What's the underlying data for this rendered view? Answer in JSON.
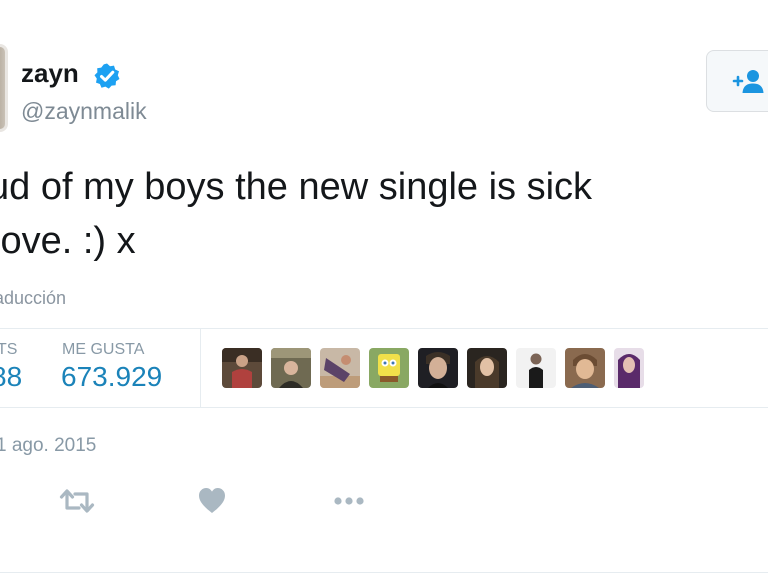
{
  "author": {
    "name": "zayn",
    "handle": "@zaynmalik",
    "verified_icon": "verified-badge-icon",
    "avatar": "profile-photo"
  },
  "follow_button": {
    "icon": "follow-person-plus-icon"
  },
  "tweet": {
    "line_1": "ud of my boys the new single is sick",
    "line_2": "love. :) x",
    "translate_label": "aducción"
  },
  "stats": {
    "retweets_label": "TS",
    "retweets_value": "88",
    "likes_label": "ME GUSTA",
    "likes_value": "673.929"
  },
  "likers": [
    {
      "name": "liker-avatar-1"
    },
    {
      "name": "liker-avatar-2"
    },
    {
      "name": "liker-avatar-3"
    },
    {
      "name": "liker-avatar-4"
    },
    {
      "name": "liker-avatar-5"
    },
    {
      "name": "liker-avatar-6"
    },
    {
      "name": "liker-avatar-7"
    },
    {
      "name": "liker-avatar-8"
    },
    {
      "name": "liker-avatar-9"
    }
  ],
  "date": "1 ago. 2015",
  "actions": {
    "retweet_icon": "retweet-icon",
    "like_icon": "heart-icon",
    "more_icon": "more-dots-icon"
  },
  "colors": {
    "accent_blue": "#1b83b9",
    "verified_blue": "#1da1f2",
    "muted_gray": "#8899a6",
    "text_dark": "#14171a"
  }
}
